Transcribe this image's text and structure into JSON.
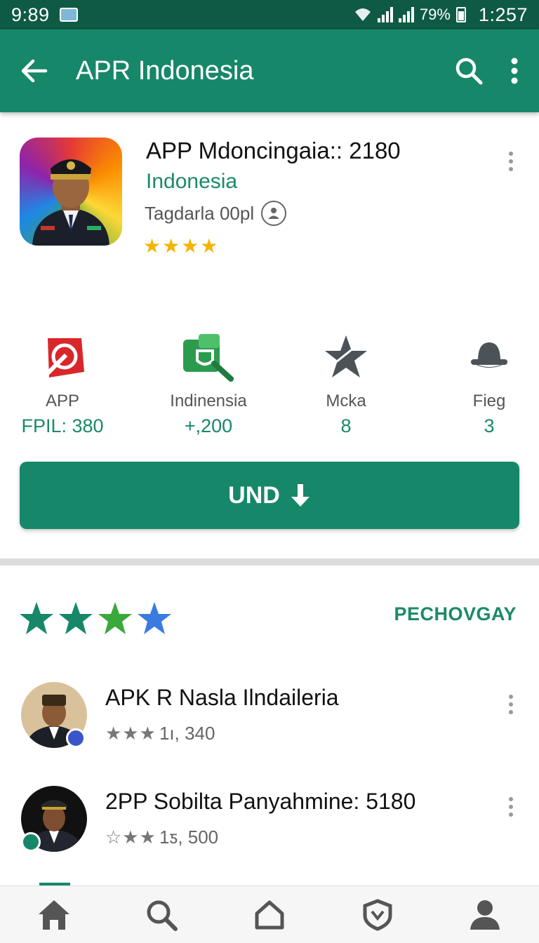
{
  "status_bar": {
    "time": "9:89",
    "battery_text": "79%",
    "clock": "1:257"
  },
  "app_bar": {
    "title": "APR Indonesia",
    "icons": [
      "back-arrow-icon",
      "search-icon",
      "more-vert-icon"
    ]
  },
  "app": {
    "name": "APP Mdoncingaia:: 2180",
    "developer": "Indonesia",
    "meta": "Tagdarla 00pl",
    "stars": "★★★★",
    "rating_stars": 4
  },
  "stats": [
    {
      "icon": "red-target-icon",
      "label": "APP",
      "value": "FPIL: 380"
    },
    {
      "icon": "green-tag-icon",
      "label": "Indinensia",
      "value": "+,200"
    },
    {
      "icon": "star-badge-icon",
      "label": "Mcka",
      "value": "8"
    },
    {
      "icon": "hat-icon",
      "label": "Fieg",
      "value": "3"
    }
  ],
  "install_button": {
    "label": "UND",
    "icon": "download-arrow-icon"
  },
  "rating_section": {
    "stars": 4,
    "link": "PECHOVGAY",
    "colors": [
      "#17876a",
      "#17876a",
      "#3aa83a",
      "#3b7be0"
    ]
  },
  "reviews": [
    {
      "title": "APK R Nasla Ilndaileria",
      "stars": "★★★",
      "count": "1ı, 340"
    },
    {
      "title": "2PP Sobilta Panyahmine: 5180",
      "stars": "☆★★",
      "count": "1ƽ, 500"
    }
  ],
  "bottom_nav": [
    "home-icon",
    "search-icon",
    "house-outline-icon",
    "shield-icon",
    "profile-icon"
  ],
  "colors": {
    "primary": "#17876a",
    "status_bar": "#0f5a45",
    "accent_text": "#1a8a67",
    "star": "#f5b400"
  }
}
